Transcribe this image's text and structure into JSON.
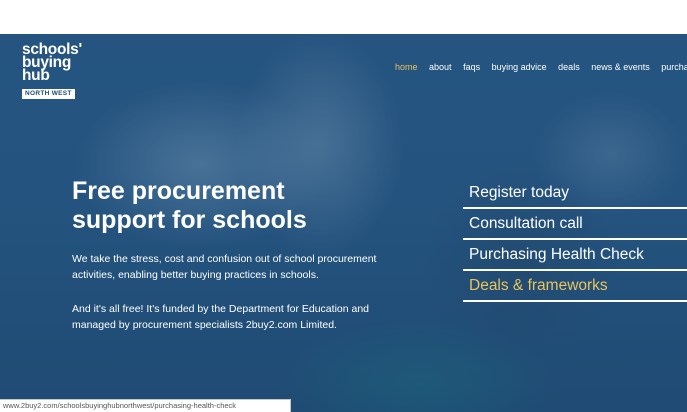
{
  "logo": {
    "line1": "schools'",
    "line2": "buying",
    "line3": "hub",
    "badge": "NORTH WEST"
  },
  "nav": {
    "items": [
      {
        "label": "home"
      },
      {
        "label": "about"
      },
      {
        "label": "faqs"
      },
      {
        "label": "buying advice"
      },
      {
        "label": "deals"
      },
      {
        "label": "news & events"
      },
      {
        "label": "purchasi"
      }
    ],
    "active_color": "#e8c45c"
  },
  "hero": {
    "headline": "Free procurement support for schools",
    "paragraph1": "We take the stress, cost and confusion out of school procurement activities, enabling better buying practices in schools.",
    "paragraph2": "And it's all free! It's funded by the Department for Education and managed by procurement specialists 2buy2.com Limited."
  },
  "menu": {
    "items": [
      {
        "label": "Register today"
      },
      {
        "label": "Consultation call"
      },
      {
        "label": "Purchasing Health Check"
      },
      {
        "label": "Deals & frameworks"
      }
    ]
  },
  "status_bar": {
    "url": "www.2buy2.com/schoolsbuyinghubnorthwest/purchasing-health-check"
  },
  "colors": {
    "hero_blue": "#2b5a84",
    "accent_gold": "#e8c45c"
  }
}
